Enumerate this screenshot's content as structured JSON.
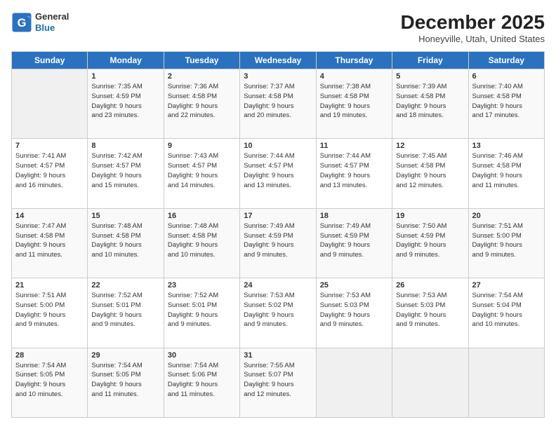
{
  "logo": {
    "line1": "General",
    "line2": "Blue"
  },
  "header": {
    "month": "December 2025",
    "location": "Honeyville, Utah, United States"
  },
  "weekdays": [
    "Sunday",
    "Monday",
    "Tuesday",
    "Wednesday",
    "Thursday",
    "Friday",
    "Saturday"
  ],
  "weeks": [
    [
      {
        "day": "",
        "sunrise": "",
        "sunset": "",
        "daylight": ""
      },
      {
        "day": "1",
        "sunrise": "Sunrise: 7:35 AM",
        "sunset": "Sunset: 4:59 PM",
        "daylight": "Daylight: 9 hours and 23 minutes."
      },
      {
        "day": "2",
        "sunrise": "Sunrise: 7:36 AM",
        "sunset": "Sunset: 4:58 PM",
        "daylight": "Daylight: 9 hours and 22 minutes."
      },
      {
        "day": "3",
        "sunrise": "Sunrise: 7:37 AM",
        "sunset": "Sunset: 4:58 PM",
        "daylight": "Daylight: 9 hours and 20 minutes."
      },
      {
        "day": "4",
        "sunrise": "Sunrise: 7:38 AM",
        "sunset": "Sunset: 4:58 PM",
        "daylight": "Daylight: 9 hours and 19 minutes."
      },
      {
        "day": "5",
        "sunrise": "Sunrise: 7:39 AM",
        "sunset": "Sunset: 4:58 PM",
        "daylight": "Daylight: 9 hours and 18 minutes."
      },
      {
        "day": "6",
        "sunrise": "Sunrise: 7:40 AM",
        "sunset": "Sunset: 4:58 PM",
        "daylight": "Daylight: 9 hours and 17 minutes."
      }
    ],
    [
      {
        "day": "7",
        "sunrise": "Sunrise: 7:41 AM",
        "sunset": "Sunset: 4:57 PM",
        "daylight": "Daylight: 9 hours and 16 minutes."
      },
      {
        "day": "8",
        "sunrise": "Sunrise: 7:42 AM",
        "sunset": "Sunset: 4:57 PM",
        "daylight": "Daylight: 9 hours and 15 minutes."
      },
      {
        "day": "9",
        "sunrise": "Sunrise: 7:43 AM",
        "sunset": "Sunset: 4:57 PM",
        "daylight": "Daylight: 9 hours and 14 minutes."
      },
      {
        "day": "10",
        "sunrise": "Sunrise: 7:44 AM",
        "sunset": "Sunset: 4:57 PM",
        "daylight": "Daylight: 9 hours and 13 minutes."
      },
      {
        "day": "11",
        "sunrise": "Sunrise: 7:44 AM",
        "sunset": "Sunset: 4:57 PM",
        "daylight": "Daylight: 9 hours and 13 minutes."
      },
      {
        "day": "12",
        "sunrise": "Sunrise: 7:45 AM",
        "sunset": "Sunset: 4:58 PM",
        "daylight": "Daylight: 9 hours and 12 minutes."
      },
      {
        "day": "13",
        "sunrise": "Sunrise: 7:46 AM",
        "sunset": "Sunset: 4:58 PM",
        "daylight": "Daylight: 9 hours and 11 minutes."
      }
    ],
    [
      {
        "day": "14",
        "sunrise": "Sunrise: 7:47 AM",
        "sunset": "Sunset: 4:58 PM",
        "daylight": "Daylight: 9 hours and 11 minutes."
      },
      {
        "day": "15",
        "sunrise": "Sunrise: 7:48 AM",
        "sunset": "Sunset: 4:58 PM",
        "daylight": "Daylight: 9 hours and 10 minutes."
      },
      {
        "day": "16",
        "sunrise": "Sunrise: 7:48 AM",
        "sunset": "Sunset: 4:58 PM",
        "daylight": "Daylight: 9 hours and 10 minutes."
      },
      {
        "day": "17",
        "sunrise": "Sunrise: 7:49 AM",
        "sunset": "Sunset: 4:59 PM",
        "daylight": "Daylight: 9 hours and 9 minutes."
      },
      {
        "day": "18",
        "sunrise": "Sunrise: 7:49 AM",
        "sunset": "Sunset: 4:59 PM",
        "daylight": "Daylight: 9 hours and 9 minutes."
      },
      {
        "day": "19",
        "sunrise": "Sunrise: 7:50 AM",
        "sunset": "Sunset: 4:59 PM",
        "daylight": "Daylight: 9 hours and 9 minutes."
      },
      {
        "day": "20",
        "sunrise": "Sunrise: 7:51 AM",
        "sunset": "Sunset: 5:00 PM",
        "daylight": "Daylight: 9 hours and 9 minutes."
      }
    ],
    [
      {
        "day": "21",
        "sunrise": "Sunrise: 7:51 AM",
        "sunset": "Sunset: 5:00 PM",
        "daylight": "Daylight: 9 hours and 9 minutes."
      },
      {
        "day": "22",
        "sunrise": "Sunrise: 7:52 AM",
        "sunset": "Sunset: 5:01 PM",
        "daylight": "Daylight: 9 hours and 9 minutes."
      },
      {
        "day": "23",
        "sunrise": "Sunrise: 7:52 AM",
        "sunset": "Sunset: 5:01 PM",
        "daylight": "Daylight: 9 hours and 9 minutes."
      },
      {
        "day": "24",
        "sunrise": "Sunrise: 7:53 AM",
        "sunset": "Sunset: 5:02 PM",
        "daylight": "Daylight: 9 hours and 9 minutes."
      },
      {
        "day": "25",
        "sunrise": "Sunrise: 7:53 AM",
        "sunset": "Sunset: 5:03 PM",
        "daylight": "Daylight: 9 hours and 9 minutes."
      },
      {
        "day": "26",
        "sunrise": "Sunrise: 7:53 AM",
        "sunset": "Sunset: 5:03 PM",
        "daylight": "Daylight: 9 hours and 9 minutes."
      },
      {
        "day": "27",
        "sunrise": "Sunrise: 7:54 AM",
        "sunset": "Sunset: 5:04 PM",
        "daylight": "Daylight: 9 hours and 10 minutes."
      }
    ],
    [
      {
        "day": "28",
        "sunrise": "Sunrise: 7:54 AM",
        "sunset": "Sunset: 5:05 PM",
        "daylight": "Daylight: 9 hours and 10 minutes."
      },
      {
        "day": "29",
        "sunrise": "Sunrise: 7:54 AM",
        "sunset": "Sunset: 5:05 PM",
        "daylight": "Daylight: 9 hours and 11 minutes."
      },
      {
        "day": "30",
        "sunrise": "Sunrise: 7:54 AM",
        "sunset": "Sunset: 5:06 PM",
        "daylight": "Daylight: 9 hours and 11 minutes."
      },
      {
        "day": "31",
        "sunrise": "Sunrise: 7:55 AM",
        "sunset": "Sunset: 5:07 PM",
        "daylight": "Daylight: 9 hours and 12 minutes."
      },
      {
        "day": "",
        "sunrise": "",
        "sunset": "",
        "daylight": ""
      },
      {
        "day": "",
        "sunrise": "",
        "sunset": "",
        "daylight": ""
      },
      {
        "day": "",
        "sunrise": "",
        "sunset": "",
        "daylight": ""
      }
    ]
  ]
}
